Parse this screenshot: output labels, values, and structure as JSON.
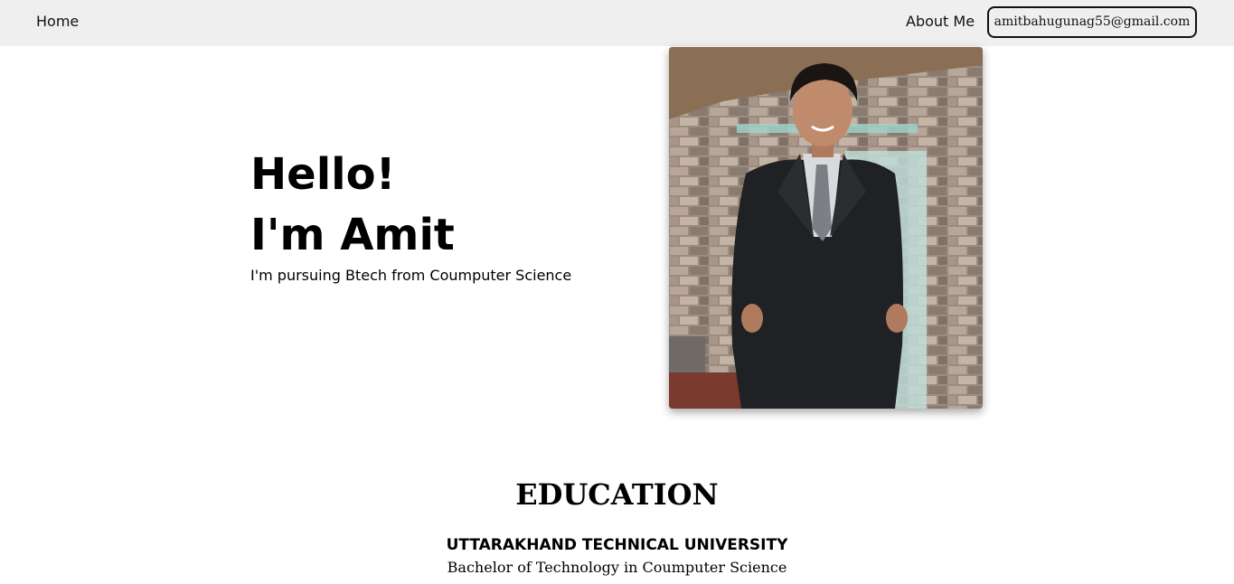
{
  "navbar": {
    "home_label": "Home",
    "about_label": "About Me",
    "email_label": "amitbahugunag55@gmail.com"
  },
  "hero": {
    "greeting": "Hello!",
    "name_line": "I'm Amit",
    "subtitle": "I'm pursuing Btech from Coumputer Science"
  },
  "education": {
    "title": "EDUCATION",
    "school": "UTTARAKHAND TECHNICAL UNIVERSITY",
    "degree": "Bachelor of Technology in Coumputer Science"
  },
  "colors": {
    "navbar_bg": "#efefef",
    "text": "#111111"
  }
}
